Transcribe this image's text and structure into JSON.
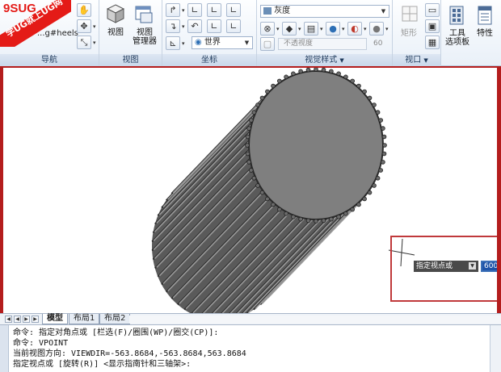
{
  "logo": {
    "line1": "9SUG",
    "line2": "学UG就上UG网"
  },
  "nav": {
    "showmotion_label": "...g#heels",
    "title": "导航"
  },
  "view_panel": {
    "view_label": "视图",
    "manager_label": "视图\n管理器",
    "title": "视图"
  },
  "ucs_panel": {
    "world_label": "世界",
    "title": "坐标"
  },
  "visual_styles": {
    "style_value": "灰度",
    "opacity_label": "不透视度",
    "opacity_value": "60",
    "title": "视觉样式"
  },
  "viewport_panel": {
    "rect_label": "矩形",
    "title": "视口"
  },
  "tools": {
    "palettes_label": "工具\n选项板",
    "properties_label": "特性"
  },
  "prompt": {
    "label": "指定视点或",
    "value": "600"
  },
  "tabs": [
    "模型",
    "布局1",
    "布局2"
  ],
  "command_lines": [
    "命令: 指定对角点或 [栏选(F)/圈围(WP)/圈交(CP)]:",
    "命令: VPOINT",
    "当前视图方向:  VIEWDIR=-563.8684,-563.8684,563.8684",
    "指定视点或 [旋转(R)] <显示指南针和三轴架>:"
  ],
  "colors": {
    "frame": "#b41d1d",
    "ribbon_title": "#1e395b",
    "cylinder_face": "#7f7f7f",
    "cylinder_side": "#5a5a5a"
  },
  "icons": {
    "pan": "hand-icon",
    "orbit": "orbit-icon",
    "zoom": "zoom-icon",
    "cube": "view-cube-icon",
    "ucs": "ucs-icon",
    "palettes": "tool-palettes-icon",
    "properties": "properties-icon"
  }
}
